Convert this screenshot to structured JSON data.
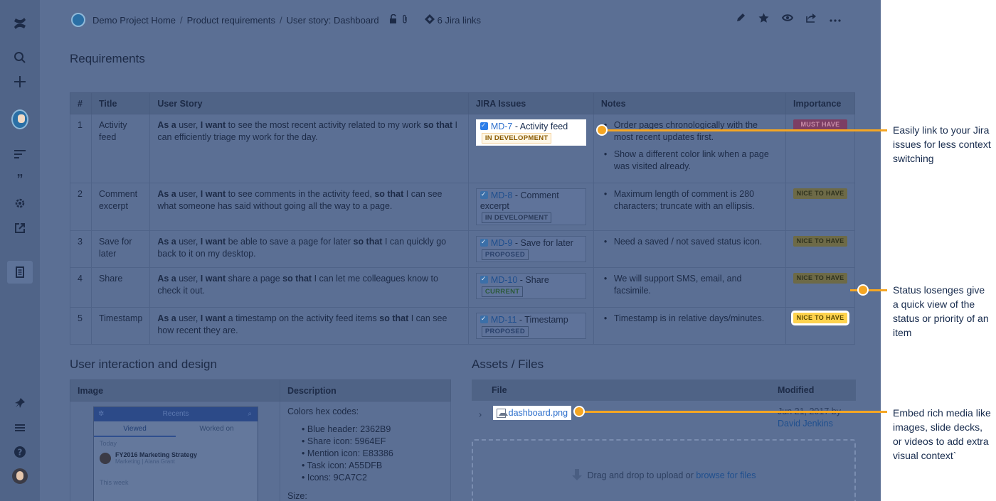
{
  "breadcrumb": {
    "items": [
      "Demo Project Home",
      "Product requirements",
      "User story: Dashboard"
    ],
    "separator": "/",
    "jira_links": "6 Jira links"
  },
  "requirements": {
    "heading": "Requirements",
    "headers": [
      "#",
      "Title",
      "User Story",
      "JIRA Issues",
      "Notes",
      "Importance"
    ],
    "rows": [
      {
        "num": "1",
        "title": "Activity feed",
        "story": [
          [
            "As a",
            true
          ],
          [
            " user, ",
            false
          ],
          [
            "I want",
            true
          ],
          [
            " to see the most recent activity related to my work ",
            false
          ],
          [
            "so that",
            true
          ],
          [
            " I can efficiently triage my work for the day.",
            false
          ]
        ],
        "jira_key": "MD-7",
        "jira_title": " - Activity feed",
        "jira_status": "IN DEVELOPMENT",
        "notes": [
          "Order pages chronologically with the most recent updates first.",
          "Show a different color link when a page was visited already."
        ],
        "importance": "MUST HAVE"
      },
      {
        "num": "2",
        "title": "Comment excerpt",
        "story": [
          [
            "As a",
            true
          ],
          [
            " user, ",
            false
          ],
          [
            "I want",
            true
          ],
          [
            " to see comments in the activity feed, ",
            false
          ],
          [
            "so that",
            true
          ],
          [
            " I can see what someone has said without going all the way to a page.",
            false
          ]
        ],
        "jira_key": "MD-8",
        "jira_title": " - Comment excerpt",
        "jira_status": "IN DEVELOPMENT",
        "notes": [
          "Maximum length of comment is 280 characters; truncate with an ellipsis."
        ],
        "importance": "NICE TO HAVE"
      },
      {
        "num": "3",
        "title": "Save for later",
        "story": [
          [
            "As a",
            true
          ],
          [
            " user, ",
            false
          ],
          [
            "I want",
            true
          ],
          [
            " be able to save a page for later ",
            false
          ],
          [
            "so that",
            true
          ],
          [
            " I can quickly go back to it on my desktop.",
            false
          ]
        ],
        "jira_key": "MD-9",
        "jira_title": " - Save for later",
        "jira_status": "PROPOSED",
        "notes": [
          "Need a saved / not saved status icon."
        ],
        "importance": "NICE TO HAVE"
      },
      {
        "num": "4",
        "title": "Share",
        "story": [
          [
            "As a",
            true
          ],
          [
            " user, ",
            false
          ],
          [
            "I want",
            true
          ],
          [
            " share a page ",
            false
          ],
          [
            "so that",
            true
          ],
          [
            " I can let me colleagues know to check it out.",
            false
          ]
        ],
        "jira_key": "MD-10",
        "jira_title": " - Share",
        "jira_status": "CURRENT",
        "notes": [
          "We will support SMS, email, and facsimile."
        ],
        "importance": "NICE TO HAVE"
      },
      {
        "num": "5",
        "title": "Timestamp",
        "story": [
          [
            "As a",
            true
          ],
          [
            " user, ",
            false
          ],
          [
            "I want",
            true
          ],
          [
            " a timestamp on the activity feed items ",
            false
          ],
          [
            "so that",
            true
          ],
          [
            " I can see how recent they are.",
            false
          ]
        ],
        "jira_key": "MD-11",
        "jira_title": " - Timestamp",
        "jira_status": "PROPOSED",
        "notes": [
          "Timestamp is in relative days/minutes."
        ],
        "importance": "NICE TO HAVE"
      }
    ]
  },
  "design": {
    "heading": "User interaction and design",
    "headers": [
      "Image",
      "Description"
    ],
    "mock": {
      "header": "Recents",
      "tabs": [
        "Viewed",
        "Worked on"
      ],
      "section_today": "Today",
      "item_title": "FY2016 Marketing Strategy",
      "item_sub": "Marketing | Alana Grant",
      "section_week": "This week"
    },
    "description_title": "Colors hex codes:",
    "colors": [
      "Blue header: 2362B9",
      "Share icon: 5964EF",
      "Mention icon: E83386",
      "Task icon: A55DFB",
      "Icons: 9CA7C2"
    ],
    "size_label": "Size:"
  },
  "assets": {
    "heading": "Assets / Files",
    "headers": [
      "File",
      "Modified"
    ],
    "file_name": "dashboard.png",
    "modified_date": "Jun 21, 2017 by",
    "modified_by": "David Jenkins",
    "drop_text": "Drag and drop to upload or ",
    "drop_link": "browse for files"
  },
  "callouts": [
    "Easily link to your Jira issues for less context switching",
    "Status losenges give a quick view of the status or priority of an item",
    "Embed rich media like images, slide decks, or videos to add extra visual context`"
  ],
  "colors": {
    "callout": "#f5a623",
    "overlay": "#5b6f94",
    "nav": "#506488"
  },
  "icons": [
    "confluence-logo-icon",
    "search-icon",
    "plus-icon",
    "lines-icon",
    "quote-icon",
    "gear-icon",
    "external-link-icon",
    "page-icon",
    "pin-icon",
    "menu-icon",
    "help-icon",
    "lock-icon",
    "attachment-icon",
    "jira-icon",
    "pencil-icon",
    "star-icon",
    "eye-icon",
    "share-icon",
    "more-icon"
  ]
}
